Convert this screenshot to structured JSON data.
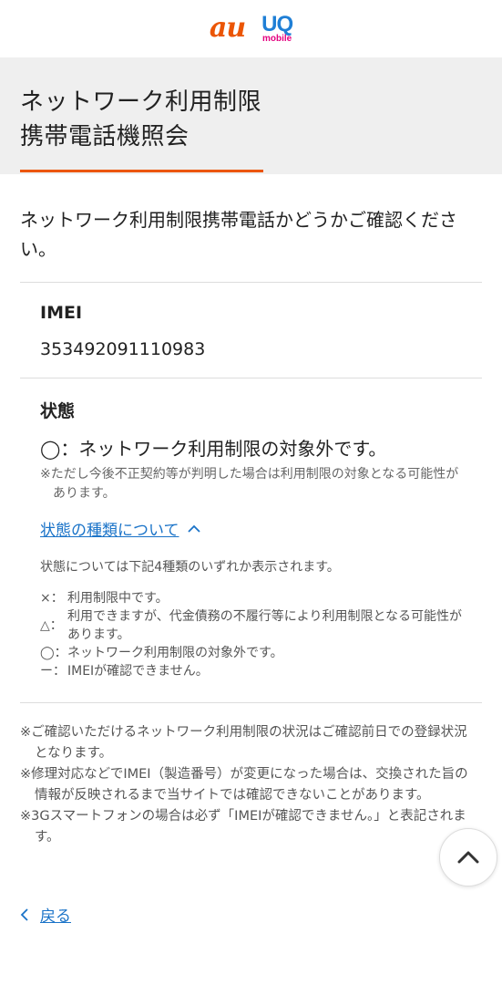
{
  "header": {
    "au_logo": "au",
    "uq_logo": "UQ",
    "uq_logo_sub": "mobile"
  },
  "title": {
    "line1": "ネットワーク利用制限",
    "line2": "携帯電話機照会"
  },
  "lead": "ネットワーク利用制限携帯電話かどうかご確認ください。",
  "imei": {
    "label": "IMEI",
    "value": "353492091110983"
  },
  "status": {
    "label": "状態",
    "result": "◯：ネットワーク利用制限の対象外です。",
    "note": "※ただし今後不正契約等が判明した場合は利用制限の対象となる可能性があります。",
    "toggle_label": "状態の種類について",
    "types_intro": "状態については下記4種類のいずれか表示されます。",
    "types": [
      {
        "symbol": "×：",
        "text": "利用制限中です。"
      },
      {
        "symbol": "△：",
        "text": "利用できますが、代金債務の不履行等により利用制限となる可能性があります。"
      },
      {
        "symbol": "◯：",
        "text": "ネットワーク利用制限の対象外です。"
      },
      {
        "symbol": "ー：",
        "text": "IMEIが確認できません。"
      }
    ]
  },
  "footnotes": [
    "※ご確認いただけるネットワーク利用制限の状況はご確認前日での登録状況となります。",
    "※修理対応などでIMEI（製造番号）が変更になった場合は、交換された旨の情報が反映されるまで当サイトでは確認できないことがあります。",
    "※3Gスマートフォンの場合は必ず「IMEIが確認できません。」と表記されます。"
  ],
  "back_label": "戻る",
  "colors": {
    "accent": "#eb5505",
    "link": "#1a73c8",
    "band": "#efefef"
  }
}
